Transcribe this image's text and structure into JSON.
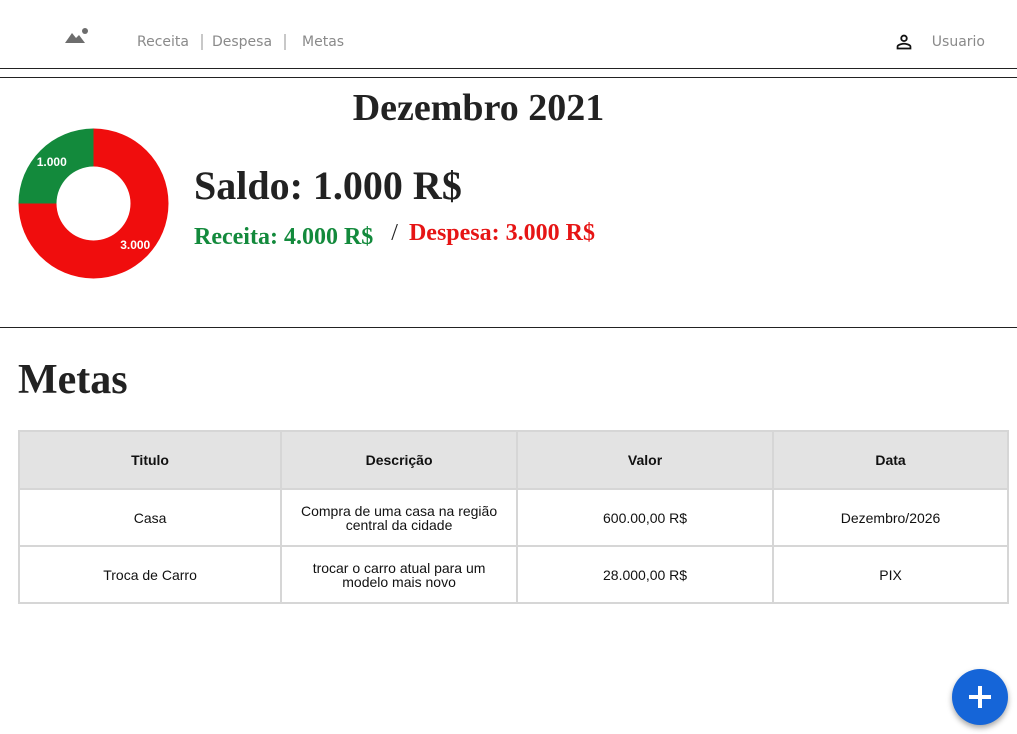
{
  "nav": {
    "logo_icon": "mountain-logo-icon",
    "links": [
      {
        "label": "Receita"
      },
      {
        "label": "Despesa"
      },
      {
        "label": "Metas"
      }
    ],
    "user_icon": "person-icon",
    "user_label": "Usuario"
  },
  "summary": {
    "month_title": "Dezembro 2021",
    "saldo": "Saldo: 1.000 R$",
    "receita": "Receita: 4.000 R$",
    "separator": "/",
    "despesa": "Despesa: 3.000 R$"
  },
  "colors": {
    "receita": "#138a3c",
    "despesa": "#e61515",
    "accent": "#1565d8"
  },
  "chart_data": {
    "type": "pie",
    "variant": "donut",
    "categories": [
      "Receita",
      "Despesa"
    ],
    "values": [
      1000,
      3000
    ],
    "labels": [
      "1.000",
      "3.000"
    ],
    "colors": [
      "#138a3c",
      "#f00d0d"
    ]
  },
  "goals": {
    "heading": "Metas",
    "columns": [
      "Titulo",
      "Descrição",
      "Valor",
      "Data"
    ],
    "rows": [
      [
        "Casa",
        "Compra de uma casa na região central da cidade",
        "600.00,00 R$",
        "Dezembro/2026"
      ],
      [
        "Troca de Carro",
        "trocar o carro atual para um modelo mais novo",
        "28.000,00 R$",
        "PIX"
      ]
    ]
  },
  "fab": {
    "icon": "plus-icon"
  }
}
